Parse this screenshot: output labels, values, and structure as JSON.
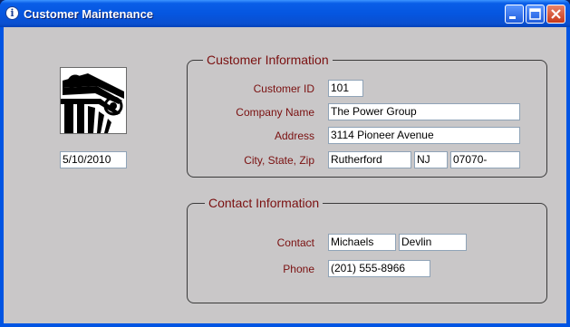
{
  "window": {
    "title": "Customer Maintenance",
    "title_icon": "info-icon"
  },
  "date": "5/10/2010",
  "customer_info": {
    "title": "Customer Information",
    "customer_id_label": "Customer ID",
    "customer_id": "101",
    "company_label": "Company Name",
    "company": "The Power Group",
    "address_label": "Address",
    "address": "3114 Pioneer Avenue",
    "csz_label": "City, State, Zip",
    "city": "Rutherford",
    "state": "NJ",
    "zip": "07070-"
  },
  "contact_info": {
    "title": "Contact Information",
    "contact_label": "Contact",
    "first_name": "Michaels",
    "last_name": "Devlin",
    "phone_label": "Phone",
    "phone": "(201) 555-8966"
  },
  "colors": {
    "label": "#7a1010",
    "background": "#c9c7c8",
    "title_bar": "#0556e0"
  }
}
